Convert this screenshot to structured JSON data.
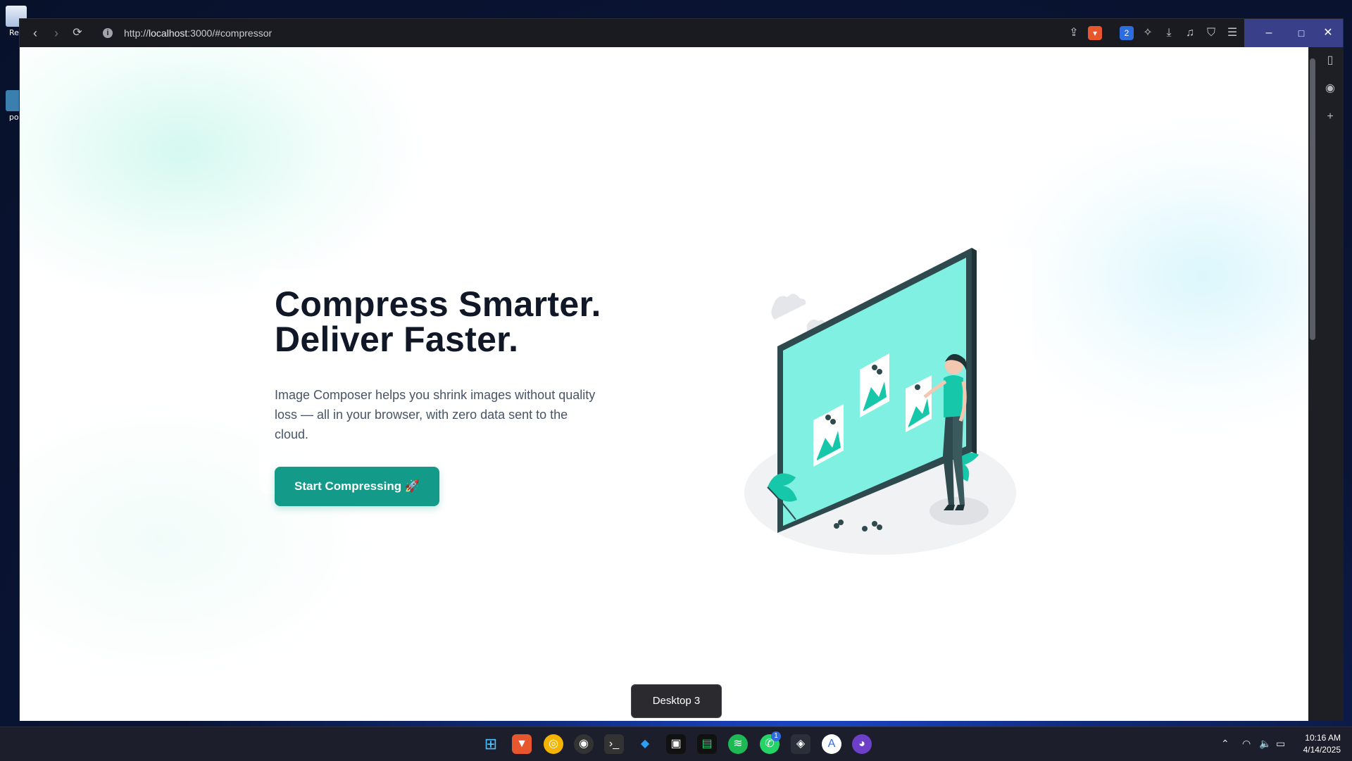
{
  "desktop": {
    "icons": [
      {
        "label": "Rec",
        "name": "recycle-bin"
      },
      {
        "label": "pov",
        "name": "desktop-shortcut"
      }
    ]
  },
  "browser": {
    "url_prefix": "http://",
    "url_host": "localhost",
    "url_rest": ":3000/#compressor",
    "window_controls": {
      "minimize": "–",
      "maximize": "□",
      "close": "✕"
    }
  },
  "page": {
    "title_line1": "Compress Smarter.",
    "title_line2": "Deliver Faster.",
    "description": "Image Composer helps you shrink images without quality loss — all in your browser, with zero data sent to the cloud.",
    "cta_label": "Start Compressing 🚀"
  },
  "tooltip": {
    "label": "Desktop 3"
  },
  "taskbar": {
    "apps": [
      "start",
      "brave",
      "chrome",
      "obs",
      "terminal",
      "vscode",
      "notion",
      "app",
      "spotify",
      "whatsapp",
      "davinci",
      "appstore",
      "github"
    ],
    "whatsapp_badge": "1",
    "time": "10:16 AM",
    "date": "4/14/2025"
  },
  "colors": {
    "accent": "#139a88",
    "heading": "#101828",
    "body_text": "#475467",
    "illustration_teal": "#7ff0e1"
  }
}
